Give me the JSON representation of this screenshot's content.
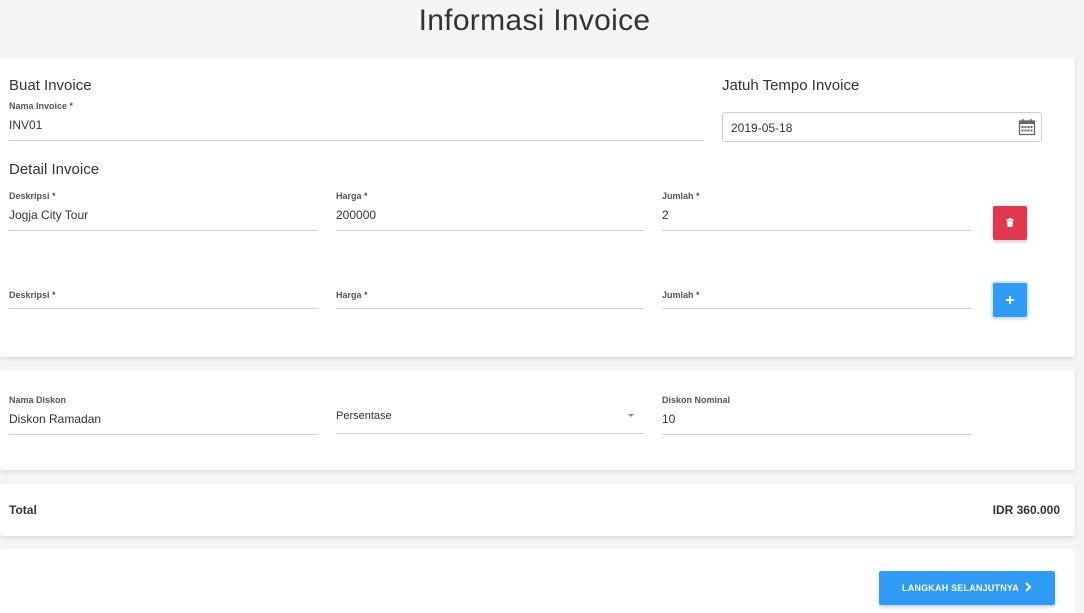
{
  "page": {
    "title": "Informasi Invoice"
  },
  "invoice": {
    "create_heading": "Buat Invoice",
    "name_label": "Nama Invoice *",
    "name_value": "INV01",
    "due_heading": "Jatuh Tempo Invoice",
    "due_value": "2019-05-18",
    "detail_heading": "Detail Invoice",
    "items": [
      {
        "desc_label": "Deskripsi *",
        "desc_value": "Jogja City Tour",
        "price_label": "Harga *",
        "price_value": "200000",
        "qty_label": "Jumlah *",
        "qty_value": "2"
      },
      {
        "desc_label": "Deskripsi *",
        "desc_value": "",
        "price_label": "Harga *",
        "price_value": "",
        "qty_label": "Jumlah *",
        "qty_value": ""
      }
    ]
  },
  "discount": {
    "name_label": "Nama Diskon",
    "name_value": "Diskon Ramadan",
    "type_value": "Persentase",
    "nominal_label": "Diskon Nominal",
    "nominal_value": "10"
  },
  "total": {
    "label": "Total",
    "value": "IDR 360.000"
  },
  "footer": {
    "next_label": "LANGKAH SELANJUTNYA"
  },
  "icons": {
    "calendar": "calendar-icon",
    "delete": "trash-icon",
    "add": "plus-icon",
    "next": "chevron-right-icon"
  },
  "colors": {
    "primary": "#2f9bf5",
    "danger": "#e0384e",
    "background": "#f4f5f7"
  }
}
